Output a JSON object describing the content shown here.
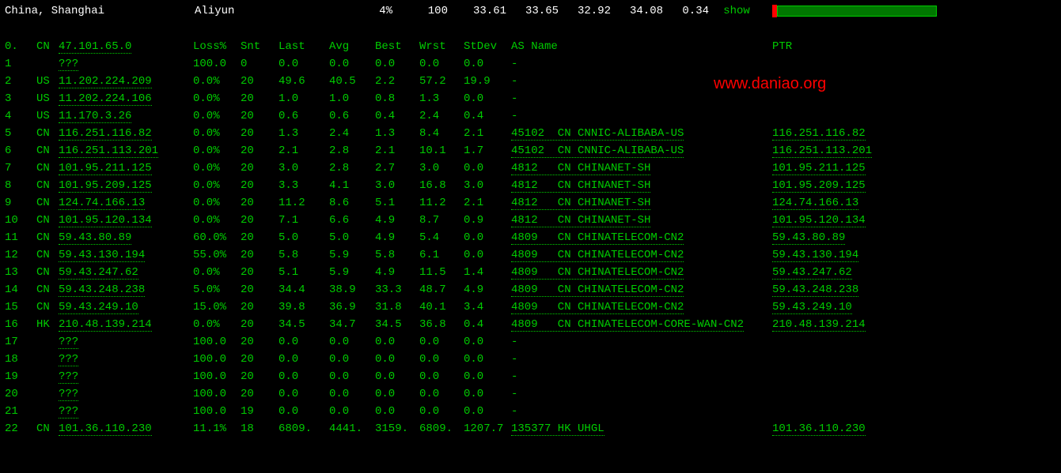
{
  "header": {
    "location": "China, Shanghai",
    "provider": "Aliyun",
    "pct": "4%",
    "v1": "100",
    "v2": "33.61",
    "v3": "33.65",
    "v4": "32.92",
    "v5": "34.08",
    "v6": "0.34",
    "action": "show"
  },
  "columns": {
    "hop": "0.",
    "cc": "CN",
    "ip": "47.101.65.0",
    "loss": "Loss%",
    "snt": "Snt",
    "last": "Last",
    "avg": "Avg",
    "best": "Best",
    "wrst": "Wrst",
    "stdev": "StDev",
    "asn": "AS Name",
    "ptr": "PTR"
  },
  "rows": [
    {
      "hop": "1",
      "cc": "",
      "ip": "???",
      "loss": "100.0",
      "snt": "0",
      "last": "0.0",
      "avg": "0.0",
      "best": "0.0",
      "wrst": "0.0",
      "stdev": "0.0",
      "asn": "-",
      "ptr": ""
    },
    {
      "hop": "2",
      "cc": "US",
      "ip": "11.202.224.209",
      "loss": "0.0%",
      "snt": "20",
      "last": "49.6",
      "avg": "40.5",
      "best": "2.2",
      "wrst": "57.2",
      "stdev": "19.9",
      "asn": "-",
      "ptr": ""
    },
    {
      "hop": "3",
      "cc": "US",
      "ip": "11.202.224.106",
      "loss": "0.0%",
      "snt": "20",
      "last": "1.0",
      "avg": "1.0",
      "best": "0.8",
      "wrst": "1.3",
      "stdev": "0.0",
      "asn": "-",
      "ptr": ""
    },
    {
      "hop": "4",
      "cc": "US",
      "ip": "11.170.3.26",
      "loss": "0.0%",
      "snt": "20",
      "last": "0.6",
      "avg": "0.6",
      "best": "0.4",
      "wrst": "2.4",
      "stdev": "0.4",
      "asn": "-",
      "ptr": ""
    },
    {
      "hop": "5",
      "cc": "CN",
      "ip": "116.251.116.82",
      "loss": "0.0%",
      "snt": "20",
      "last": "1.3",
      "avg": "2.4",
      "best": "1.3",
      "wrst": "8.4",
      "stdev": "2.1",
      "asn": "45102  CN CNNIC-ALIBABA-US",
      "ptr": "116.251.116.82"
    },
    {
      "hop": "6",
      "cc": "CN",
      "ip": "116.251.113.201",
      "loss": "0.0%",
      "snt": "20",
      "last": "2.1",
      "avg": "2.8",
      "best": "2.1",
      "wrst": "10.1",
      "stdev": "1.7",
      "asn": "45102  CN CNNIC-ALIBABA-US",
      "ptr": "116.251.113.201"
    },
    {
      "hop": "7",
      "cc": "CN",
      "ip": "101.95.211.125",
      "loss": "0.0%",
      "snt": "20",
      "last": "3.0",
      "avg": "2.8",
      "best": "2.7",
      "wrst": "3.0",
      "stdev": "0.0",
      "asn": "4812   CN CHINANET-SH",
      "ptr": "101.95.211.125"
    },
    {
      "hop": "8",
      "cc": "CN",
      "ip": "101.95.209.125",
      "loss": "0.0%",
      "snt": "20",
      "last": "3.3",
      "avg": "4.1",
      "best": "3.0",
      "wrst": "16.8",
      "stdev": "3.0",
      "asn": "4812   CN CHINANET-SH",
      "ptr": "101.95.209.125"
    },
    {
      "hop": "9",
      "cc": "CN",
      "ip": "124.74.166.13",
      "loss": "0.0%",
      "snt": "20",
      "last": "11.2",
      "avg": "8.6",
      "best": "5.1",
      "wrst": "11.2",
      "stdev": "2.1",
      "asn": "4812   CN CHINANET-SH",
      "ptr": "124.74.166.13"
    },
    {
      "hop": "10",
      "cc": "CN",
      "ip": "101.95.120.134",
      "loss": "0.0%",
      "snt": "20",
      "last": "7.1",
      "avg": "6.6",
      "best": "4.9",
      "wrst": "8.7",
      "stdev": "0.9",
      "asn": "4812   CN CHINANET-SH",
      "ptr": "101.95.120.134"
    },
    {
      "hop": "11",
      "cc": "CN",
      "ip": "59.43.80.89",
      "loss": "60.0%",
      "snt": "20",
      "last": "5.0",
      "avg": "5.0",
      "best": "4.9",
      "wrst": "5.4",
      "stdev": "0.0",
      "asn": "4809   CN CHINATELECOM-CN2",
      "ptr": "59.43.80.89"
    },
    {
      "hop": "12",
      "cc": "CN",
      "ip": "59.43.130.194",
      "loss": "55.0%",
      "snt": "20",
      "last": "5.8",
      "avg": "5.9",
      "best": "5.8",
      "wrst": "6.1",
      "stdev": "0.0",
      "asn": "4809   CN CHINATELECOM-CN2",
      "ptr": "59.43.130.194"
    },
    {
      "hop": "13",
      "cc": "CN",
      "ip": "59.43.247.62",
      "loss": "0.0%",
      "snt": "20",
      "last": "5.1",
      "avg": "5.9",
      "best": "4.9",
      "wrst": "11.5",
      "stdev": "1.4",
      "asn": "4809   CN CHINATELECOM-CN2",
      "ptr": "59.43.247.62"
    },
    {
      "hop": "14",
      "cc": "CN",
      "ip": "59.43.248.238",
      "loss": "5.0%",
      "snt": "20",
      "last": "34.4",
      "avg": "38.9",
      "best": "33.3",
      "wrst": "48.7",
      "stdev": "4.9",
      "asn": "4809   CN CHINATELECOM-CN2",
      "ptr": "59.43.248.238"
    },
    {
      "hop": "15",
      "cc": "CN",
      "ip": "59.43.249.10",
      "loss": "15.0%",
      "snt": "20",
      "last": "39.8",
      "avg": "36.9",
      "best": "31.8",
      "wrst": "40.1",
      "stdev": "3.4",
      "asn": "4809   CN CHINATELECOM-CN2",
      "ptr": "59.43.249.10"
    },
    {
      "hop": "16",
      "cc": "HK",
      "ip": "210.48.139.214",
      "loss": "0.0%",
      "snt": "20",
      "last": "34.5",
      "avg": "34.7",
      "best": "34.5",
      "wrst": "36.8",
      "stdev": "0.4",
      "asn": "4809   CN CHINATELECOM-CORE-WAN-CN2",
      "ptr": "210.48.139.214"
    },
    {
      "hop": "17",
      "cc": "",
      "ip": "???",
      "loss": "100.0",
      "snt": "20",
      "last": "0.0",
      "avg": "0.0",
      "best": "0.0",
      "wrst": "0.0",
      "stdev": "0.0",
      "asn": "-",
      "ptr": ""
    },
    {
      "hop": "18",
      "cc": "",
      "ip": "???",
      "loss": "100.0",
      "snt": "20",
      "last": "0.0",
      "avg": "0.0",
      "best": "0.0",
      "wrst": "0.0",
      "stdev": "0.0",
      "asn": "-",
      "ptr": ""
    },
    {
      "hop": "19",
      "cc": "",
      "ip": "???",
      "loss": "100.0",
      "snt": "20",
      "last": "0.0",
      "avg": "0.0",
      "best": "0.0",
      "wrst": "0.0",
      "stdev": "0.0",
      "asn": "-",
      "ptr": ""
    },
    {
      "hop": "20",
      "cc": "",
      "ip": "???",
      "loss": "100.0",
      "snt": "20",
      "last": "0.0",
      "avg": "0.0",
      "best": "0.0",
      "wrst": "0.0",
      "stdev": "0.0",
      "asn": "-",
      "ptr": ""
    },
    {
      "hop": "21",
      "cc": "",
      "ip": "???",
      "loss": "100.0",
      "snt": "19",
      "last": "0.0",
      "avg": "0.0",
      "best": "0.0",
      "wrst": "0.0",
      "stdev": "0.0",
      "asn": "-",
      "ptr": ""
    },
    {
      "hop": "22",
      "cc": "CN",
      "ip": "101.36.110.230",
      "loss": "11.1%",
      "snt": "18",
      "last": "6809.",
      "avg": "4441.",
      "best": "3159.",
      "wrst": "6809.",
      "stdev": "1207.7",
      "asn": "135377 HK UHGL",
      "ptr": "101.36.110.230"
    }
  ],
  "watermark": "www.daniao.org"
}
